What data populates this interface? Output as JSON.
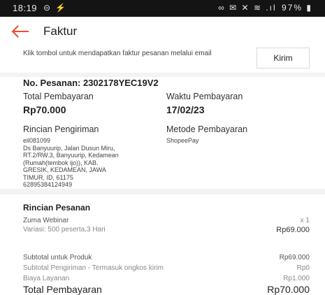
{
  "status_bar": {
    "time": "18:19",
    "left_icons": "⊝ ⚡",
    "right_icons": "∞ ✉ ✕ ≋ .ıl",
    "battery": "97%"
  },
  "appbar": {
    "title": "Faktur"
  },
  "email": {
    "text": "Klik tombol untuk mendapatkan faktur pesanan melalui email",
    "button": "Kirim"
  },
  "order": {
    "id": "No. Pesanan: 2302178YEC19V2",
    "total_label": "Total Pembayaran",
    "total_value": "Rp70.000",
    "time_label": "Waktu Pembayaran",
    "time_value": "17/02/23"
  },
  "shipping": {
    "label": "Rincian Pengiriman",
    "lines": [
      "eil081099",
      "Ds Banyuurip, Jalan Dusun Miru,",
      "RT.2/RW.3, Banyuurip, Kedamean",
      "(Rumah(tembok ijo)), KAB.",
      "GRESIK, KEDAMEAN, JAWA",
      "TIMUR, ID, 61175",
      "62895384124949"
    ],
    "payment_label": "Metode Pembayaran",
    "payment_value": "ShopeePay"
  },
  "details": {
    "title": "Rincian Pesanan",
    "product": "Zuma Webinar",
    "qty": "x 1",
    "variant": "Variasi: 500 peserta,3 Hari",
    "price": "Rp69.000",
    "subtotal_label": "Subtotal untuk Produk",
    "subtotal_value": "Rp69.000",
    "shipping_label": "Subtotal Pengiriman - Termasuk ongkos kirim",
    "shipping_value": "Rp0",
    "fee_label": "Biaya Layanan",
    "fee_value": "Rp1.000",
    "grand_label": "Total Pembayaran",
    "grand_value": "Rp70.000"
  }
}
